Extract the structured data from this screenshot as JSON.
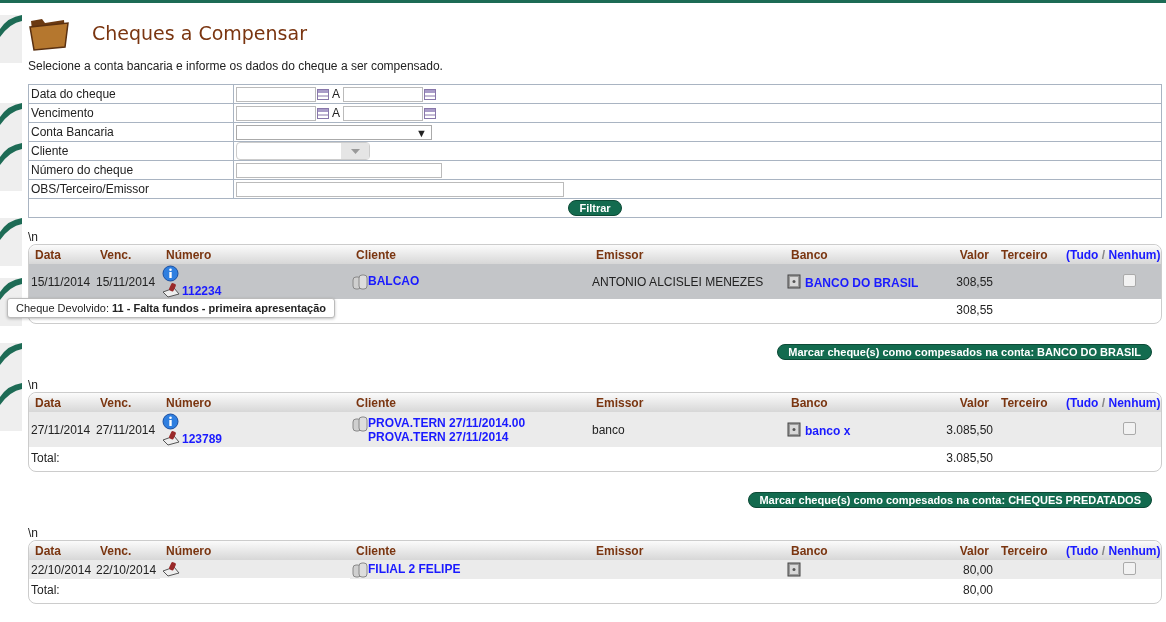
{
  "title": "Cheques a Compensar",
  "subtitle": "Selecione a conta bancaria e informe os dados do cheque a ser compensado.",
  "filters": [
    {
      "label": "Data do cheque",
      "kind": "date-range",
      "separator": "A"
    },
    {
      "label": "Vencimento",
      "kind": "date-range",
      "separator": "A"
    },
    {
      "label": "Conta Bancaria",
      "kind": "select",
      "arrow": "▼"
    },
    {
      "label": "Cliente",
      "kind": "combo"
    },
    {
      "label": "Número do cheque",
      "kind": "text"
    },
    {
      "label": "OBS/Terceiro/Emissor",
      "kind": "long-text"
    }
  ],
  "filter_button": "Filtrar",
  "groups": [
    {
      "marker": "\\n",
      "columns": [
        "Data",
        "Venc.",
        "Número",
        "Cliente",
        "Emissor",
        "Banco",
        "Valor",
        "Terceiro"
      ],
      "select_all": {
        "tudo": "(Tudo",
        "separator": "/",
        "nenhum": "Nenhum)"
      },
      "rows": [
        {
          "data": "15/11/2014",
          "venc": "15/11/2014",
          "info": true,
          "numero": "112234",
          "cliente": "BALCAO",
          "emissor": "ANTONIO ALCISLEI MENEZES",
          "banco": "BANCO DO BRASIL",
          "valor": "308,55",
          "highlighted": true,
          "checked": false
        }
      ],
      "total": "308,55",
      "tooltip": "Cheque Devolvido: **11 - Falta fundos - primeira apresentação**",
      "mark_button": "Marcar cheque(s) como compesados na conta: BANCO DO BRASIL"
    },
    {
      "marker": "\\n",
      "columns": [
        "Data",
        "Venc.",
        "Número",
        "Cliente",
        "Emissor",
        "Banco",
        "Valor",
        "Terceiro"
      ],
      "select_all": {
        "tudo": "(Tudo",
        "separator": "/",
        "nenhum": "Nenhum)"
      },
      "rows": [
        {
          "data": "27/11/2014",
          "venc": "27/11/2014",
          "info": true,
          "numero": "123789",
          "cliente": "PROVA.TERN 27/11/2014.00 PROVA.TERN 27/11/2014",
          "emissor": "banco",
          "banco": "banco x",
          "valor": "3.085,50",
          "highlighted": false,
          "checked": false
        }
      ],
      "total_label": "Total:",
      "total": "3.085,50",
      "mark_button": "Marcar cheque(s) como compesados na conta: CHEQUES PREDATADOS"
    },
    {
      "marker": "\\n",
      "columns": [
        "Data",
        "Venc.",
        "Número",
        "Cliente",
        "Emissor",
        "Banco",
        "Valor",
        "Terceiro"
      ],
      "select_all": {
        "tudo": "(Tudo",
        "separator": "/",
        "nenhum": "Nenhum)"
      },
      "rows": [
        {
          "data": "22/10/2014",
          "venc": "22/10/2014",
          "info": false,
          "cliente": "FILIAL 2 FELIPE",
          "valor": "80,00",
          "highlighted": false,
          "checked": false
        }
      ],
      "total_label": "Total:",
      "total": "80,00"
    }
  ]
}
